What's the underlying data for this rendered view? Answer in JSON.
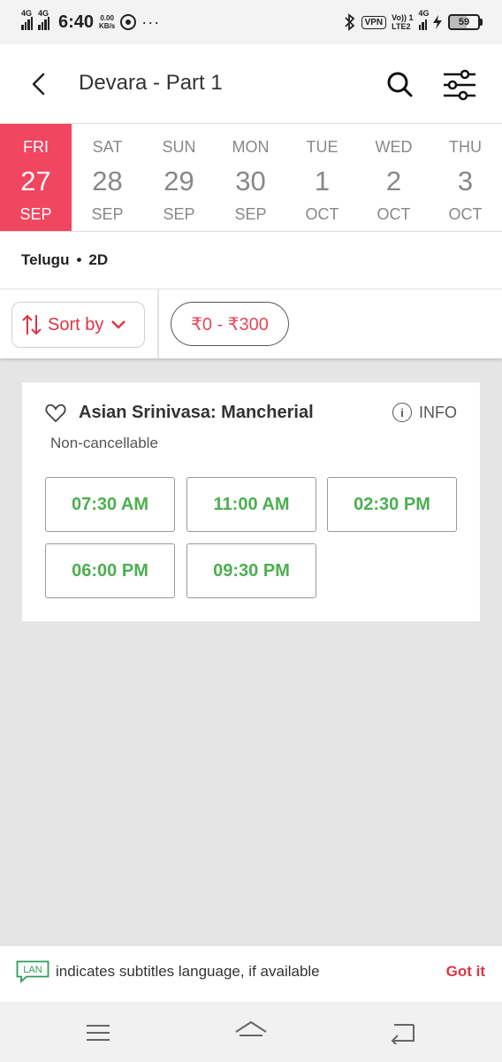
{
  "status_bar": {
    "network1": "4G",
    "network2": "4G",
    "time": "6:40",
    "speed_value": "0.00",
    "speed_unit": "KB/s",
    "vpn": "VPN",
    "volte_top": "Vo)) 1",
    "volte_bottom": "LTE2",
    "network3": "4G",
    "battery": "59"
  },
  "header": {
    "title": "Devara - Part 1"
  },
  "dates": [
    {
      "dow": "FRI",
      "num": "27",
      "mon": "SEP",
      "selected": true
    },
    {
      "dow": "SAT",
      "num": "28",
      "mon": "SEP",
      "selected": false
    },
    {
      "dow": "SUN",
      "num": "29",
      "mon": "SEP",
      "selected": false
    },
    {
      "dow": "MON",
      "num": "30",
      "mon": "SEP",
      "selected": false
    },
    {
      "dow": "TUE",
      "num": "1",
      "mon": "OCT",
      "selected": false
    },
    {
      "dow": "WED",
      "num": "2",
      "mon": "OCT",
      "selected": false
    },
    {
      "dow": "THU",
      "num": "3",
      "mon": "OCT",
      "selected": false
    }
  ],
  "format": {
    "language": "Telugu",
    "separator": "•",
    "dimension": "2D"
  },
  "filters": {
    "sort_label": "Sort by",
    "price_range": "₹0 - ₹300"
  },
  "cinema": {
    "name": "Asian Srinivasa: Mancherial",
    "info_label": "INFO",
    "info_icon": "i",
    "cancellation": "Non-cancellable",
    "showtimes": [
      "07:30 AM",
      "11:00 AM",
      "02:30 PM",
      "06:00 PM",
      "09:30 PM"
    ]
  },
  "info_bar": {
    "badge": "LAN",
    "text": "indicates subtitles language, if available",
    "action": "Got it"
  },
  "colors": {
    "brand": "#f1465f",
    "accent_red": "#dc3545",
    "available_green": "#4caf50"
  }
}
